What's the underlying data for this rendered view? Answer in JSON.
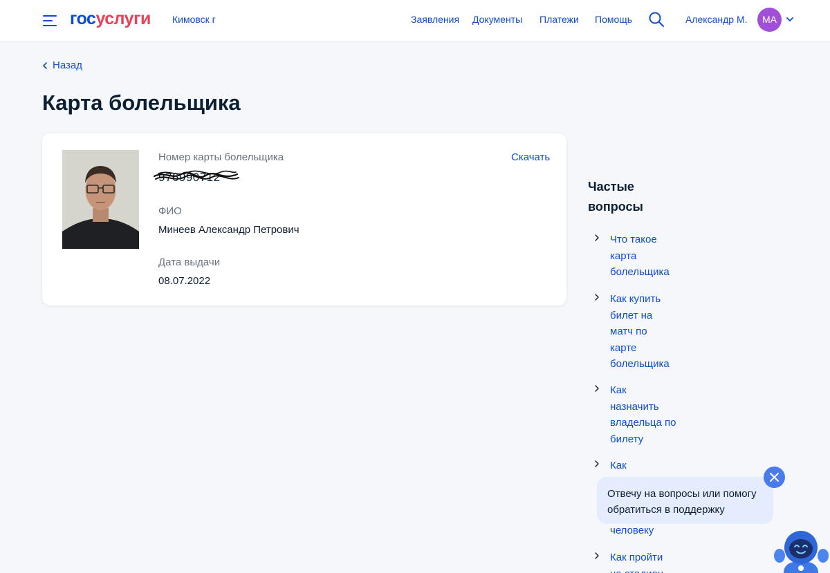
{
  "header": {
    "logo_part1": "гос",
    "logo_part2": "услуги",
    "city": "Кимовск г",
    "nav": [
      "Заявления",
      "Документы",
      "Платежи",
      "Помощь"
    ],
    "user_name": "Александр М.",
    "avatar_initials": "МА"
  },
  "page": {
    "back_label": "Назад",
    "title": "Карта болельщика"
  },
  "card": {
    "number_label": "Номер карты болельщика",
    "number_value": "976990712",
    "download_label": "Скачать",
    "fio_label": "ФИО",
    "fio_value": "Минеев Александр Петрович",
    "date_label": "Дата выдачи",
    "date_value": "08.07.2022"
  },
  "faq": {
    "title": "Частые вопросы",
    "items": [
      "Что такое карта болельщика",
      "Как купить билет на матч по карте болельщика",
      "Как назначить владельца по билету",
      "Как",
      "человеку",
      "Как пройти на стадион"
    ]
  },
  "chat": {
    "message": "Отвечу на вопросы или помогу обратиться в поддержку"
  },
  "colors": {
    "accent": "#0d4cd3",
    "brand_red": "#ee3f58",
    "avatar": "#a14fd8",
    "background": "#f5f7fa"
  }
}
